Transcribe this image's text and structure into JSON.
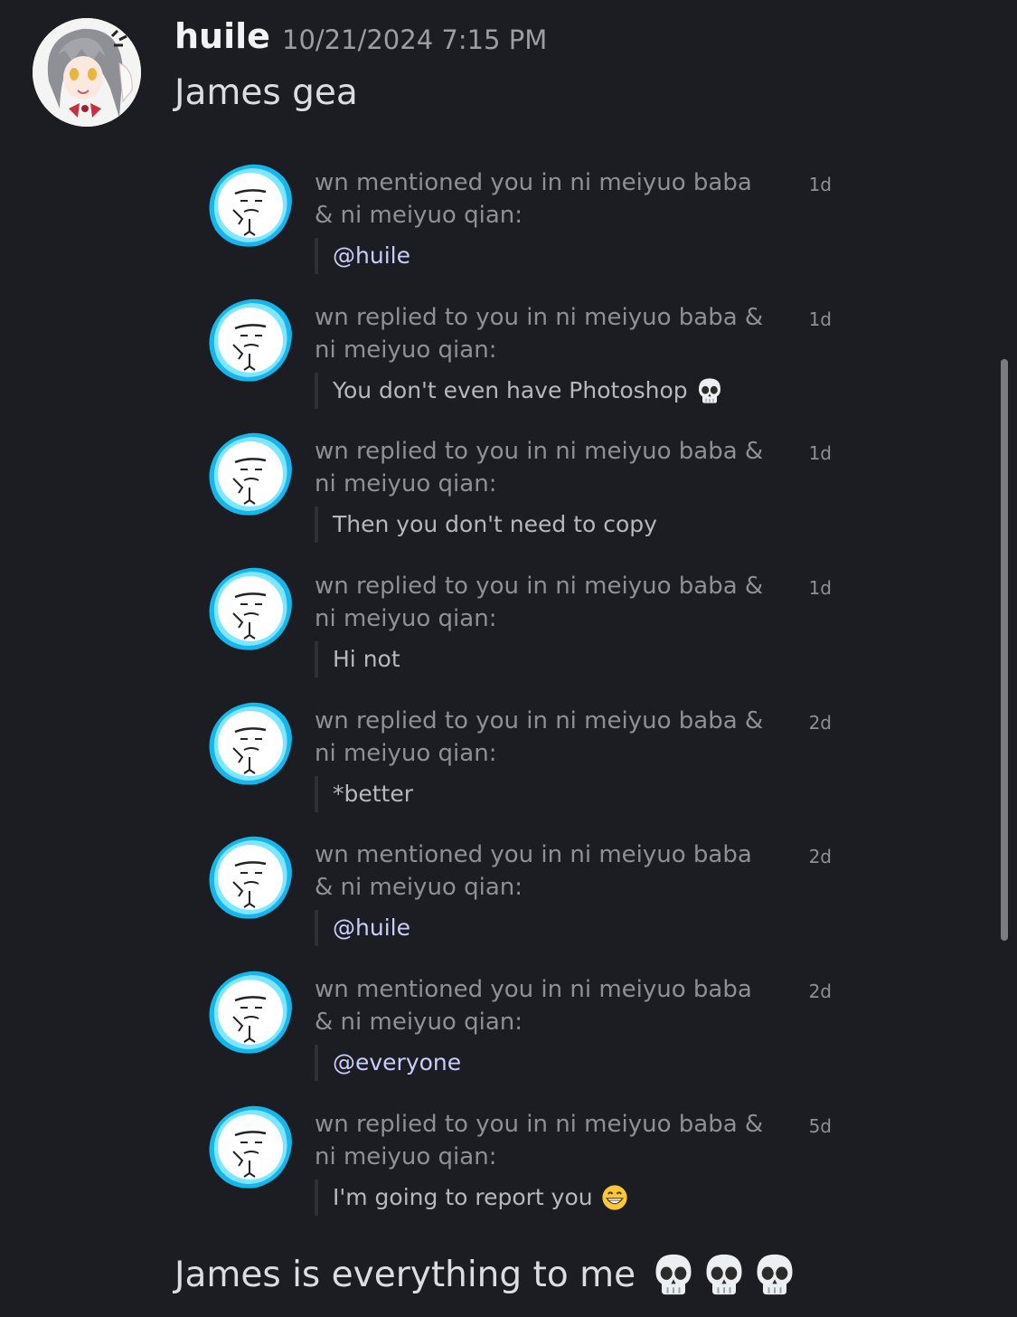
{
  "message": {
    "author": "huile",
    "timestamp": "10/21/2024 7:15 PM",
    "text": "James gea",
    "followup_text": "James is everything to me",
    "followup_emoji": [
      "skull",
      "skull",
      "skull"
    ]
  },
  "notifications": [
    {
      "text": "wn mentioned you in ni meiyuo baba & ni meiyuo qian:",
      "age": "1d",
      "quote": "@huile",
      "mention": true,
      "emoji": ""
    },
    {
      "text": "wn replied to you in ni meiyuo baba & ni meiyuo qian:",
      "age": "1d",
      "quote": "You don't even have Photoshop",
      "mention": false,
      "emoji": "skull"
    },
    {
      "text": "wn replied to you in ni meiyuo baba & ni meiyuo qian:",
      "age": "1d",
      "quote": "Then you don't need to copy",
      "mention": false,
      "emoji": ""
    },
    {
      "text": "wn replied to you in ni meiyuo baba & ni meiyuo qian:",
      "age": "1d",
      "quote": "Hi not",
      "mention": false,
      "emoji": ""
    },
    {
      "text": "wn replied to you in ni meiyuo baba & ni meiyuo qian:",
      "age": "2d",
      "quote": "*better",
      "mention": false,
      "emoji": ""
    },
    {
      "text": "wn mentioned you in ni meiyuo baba & ni meiyuo qian:",
      "age": "2d",
      "quote": "@huile",
      "mention": true,
      "emoji": ""
    },
    {
      "text": "wn mentioned you in ni meiyuo baba & ni meiyuo qian:",
      "age": "2d",
      "quote": "@everyone",
      "mention": true,
      "emoji": ""
    },
    {
      "text": "wn replied to you in ni meiyuo baba & ni meiyuo qian:",
      "age": "5d",
      "quote": "I'm going to report you",
      "mention": false,
      "emoji": "grin"
    }
  ],
  "colors": {
    "background": "#1c1d22",
    "author": "#f2f3f5",
    "timestamp": "#9b9ea5",
    "notif_text": "#8e9097",
    "mention": "#c9cdfb",
    "avatar_glow": "#1ec8f0"
  }
}
